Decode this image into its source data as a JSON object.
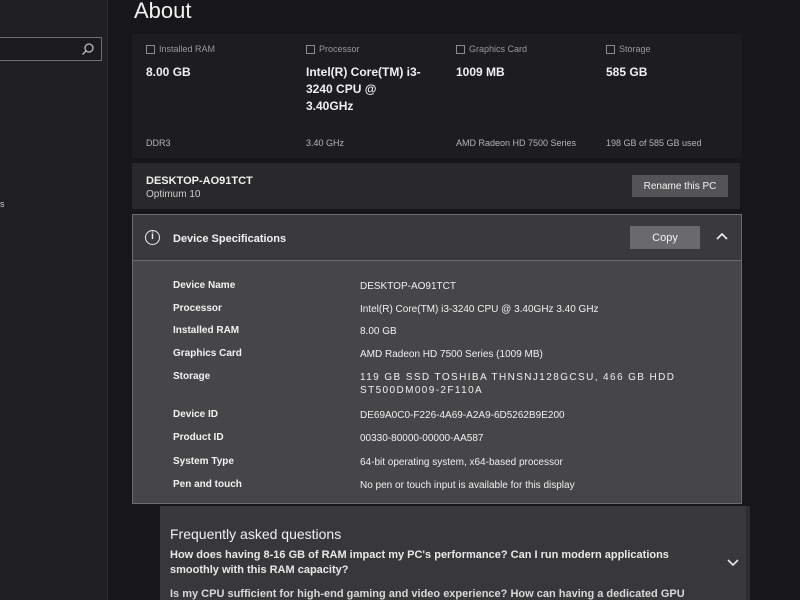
{
  "page": {
    "title": "About"
  },
  "sidebar": {
    "fragment": "s"
  },
  "tiles": [
    {
      "label": "Installed RAM",
      "value": "8.00 GB",
      "sub": "DDR3"
    },
    {
      "label": "Processor",
      "value": "Intel(R) Core(TM) i3-3240 CPU @ 3.40GHz",
      "sub": "3.40 GHz"
    },
    {
      "label": "Graphics Card",
      "value": "1009 MB",
      "sub": "AMD Radeon HD 7500 Series"
    },
    {
      "label": "Storage",
      "value": "585 GB",
      "sub": "198 GB of 585 GB used"
    }
  ],
  "device": {
    "name": "DESKTOP-AO91TCT",
    "edition": "Optimum 10",
    "rename_label": "Rename this PC"
  },
  "specs": {
    "title": "Device Specifications",
    "copy_label": "Copy",
    "rows": [
      {
        "label": "Device Name",
        "value": "DESKTOP-AO91TCT"
      },
      {
        "label": "Processor",
        "value": "Intel(R) Core(TM) i3-3240 CPU @ 3.40GHz   3.40 GHz"
      },
      {
        "label": "Installed RAM",
        "value": "8.00 GB"
      },
      {
        "label": "Graphics Card",
        "value": "AMD Radeon HD 7500 Series (1009 MB)"
      },
      {
        "label": "Storage",
        "value": "119 GB SSD TOSHIBA THNSNJ128GCSU, 466 GB HDD ST500DM009-2F110A"
      },
      {
        "label": "Device ID",
        "value": "DE69A0C0-F226-4A69-A2A9-6D5262B9E200"
      },
      {
        "label": "Product ID",
        "value": "00330-80000-00000-AA587"
      },
      {
        "label": "System Type",
        "value": "64-bit operating system, x64-based processor"
      },
      {
        "label": "Pen and touch",
        "value": "No pen or touch input is available for this display"
      }
    ]
  },
  "faq": {
    "title": "Frequently asked questions",
    "q1": "How does having 8-16 GB of RAM impact my PC's performance? Can I run modern applications smoothly with this RAM capacity?",
    "q2": "Is my CPU sufficient for high-end gaming and video experience? How can having a dedicated GPU"
  },
  "colors": {
    "background": "#17171a",
    "panel": "#464649",
    "button": "#6a6a6d"
  }
}
